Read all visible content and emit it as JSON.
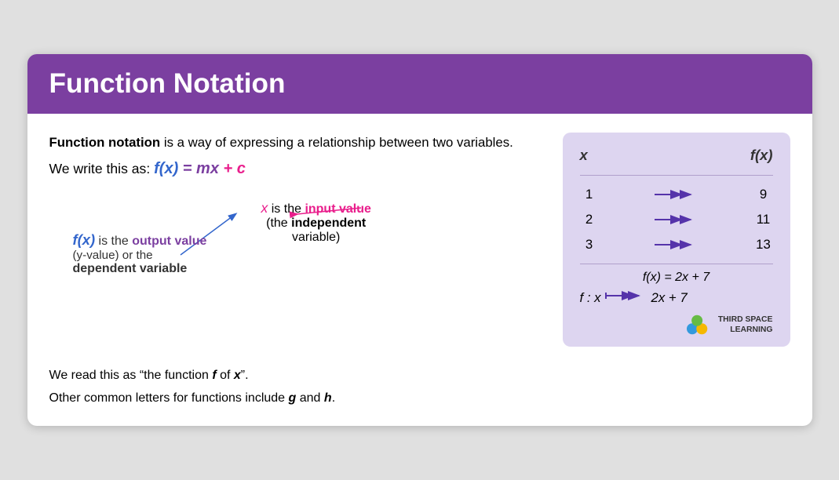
{
  "header": {
    "title": "Function Notation",
    "bg_color": "#7b3fa0"
  },
  "intro": {
    "text_part1": "Function notation",
    "text_part2": " is a way of expressing a relationship between two variables.",
    "formula_prefix": "We write this as: ",
    "formula_main": "f(x) = mx + c"
  },
  "output_annotation": {
    "fx": "f(x)",
    "line1": " is the ",
    "output_word": "output value",
    "line2": "(y-value) or the",
    "line3": "dependent variable"
  },
  "input_annotation": {
    "x": "x",
    "line1": " is the ",
    "input_word": "input value",
    "line2": "(the ",
    "indep_word": "independent",
    "line3": "variable)"
  },
  "bottom": {
    "line1_prefix": "We read this as “the function ",
    "line1_f": "f",
    "line1_mid": " of ",
    "line1_x": "x",
    "line1_suffix": "”.",
    "line2_prefix": "Other common letters for functions include ",
    "line2_g": "g",
    "line2_mid": " and ",
    "line2_h": "h",
    "line2_suffix": "."
  },
  "table": {
    "col1": "x",
    "col2": "f(x)",
    "rows": [
      {
        "x": "1",
        "fx": "9"
      },
      {
        "x": "2",
        "fx": "11"
      },
      {
        "x": "3",
        "fx": "13"
      }
    ],
    "formula": "f(x) = 2x + 7",
    "mapping_left": "f : x",
    "mapping_right": "2x + 7"
  },
  "logo": {
    "text_line1": "THIRD SPACE",
    "text_line2": "LEARNING"
  }
}
